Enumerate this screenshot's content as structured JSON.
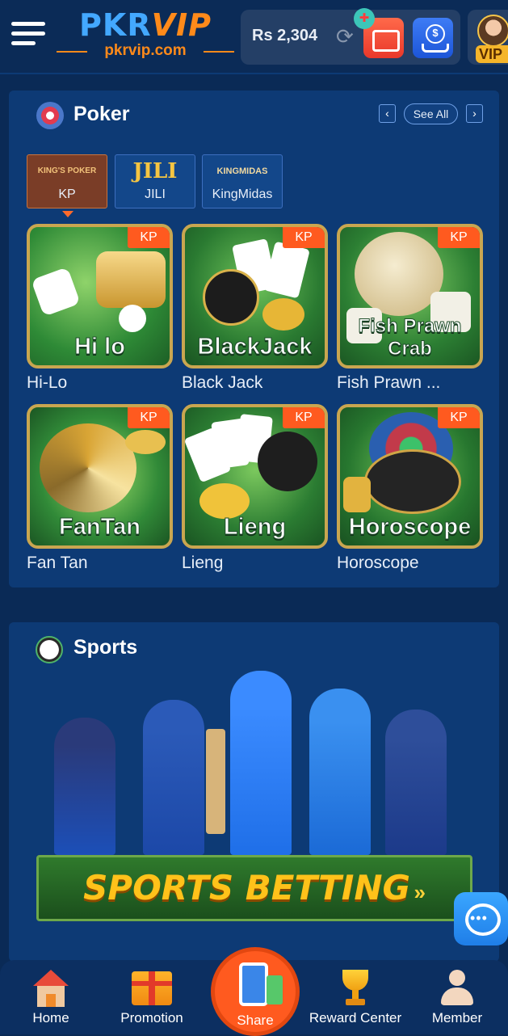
{
  "header": {
    "logo_main_1": "PKR",
    "logo_main_2": "VIP",
    "logo_sub": "pkrvip.com",
    "balance": "Rs 2,304",
    "vip_badge": "VIP"
  },
  "poker": {
    "title": "Poker",
    "see_all": "See All",
    "providers": [
      {
        "logo": "KING'S POKER",
        "label": "KP"
      },
      {
        "logo": "JILI",
        "label": "JILI"
      },
      {
        "logo": "KINGMIDAS",
        "label": "KingMidas"
      }
    ],
    "games": [
      {
        "art": "Hi lo",
        "name": "Hi-Lo",
        "tag": "KP"
      },
      {
        "art": "BlackJack",
        "name": "Black Jack",
        "tag": "KP"
      },
      {
        "art": "Fish Prawn Crab",
        "name": "Fish Prawn ...",
        "tag": "KP"
      },
      {
        "art": "FanTan",
        "name": "Fan Tan",
        "tag": "KP"
      },
      {
        "art": "Lieng",
        "name": "Lieng",
        "tag": "KP"
      },
      {
        "art": "Horoscope",
        "name": "Horoscope",
        "tag": "KP"
      }
    ]
  },
  "sports": {
    "title": "Sports",
    "banner_text": "SPORTS BETTING"
  },
  "bottom_nav": {
    "home": "Home",
    "promotion": "Promotion",
    "share": "Share",
    "reward_center": "Reward Center",
    "member": "Member"
  },
  "icons": [
    "menu-icon",
    "refresh-icon",
    "deposit-icon",
    "gift-icon",
    "withdraw-icon",
    "poker-chip-icon",
    "soccer-ball-icon",
    "support-icon",
    "home-icon",
    "gift-box-icon",
    "share-icon",
    "trophy-icon",
    "person-icon"
  ],
  "colors": {
    "accent": "#ff5a1f",
    "background": "#0a2a56",
    "panel": "#0d3a75"
  }
}
